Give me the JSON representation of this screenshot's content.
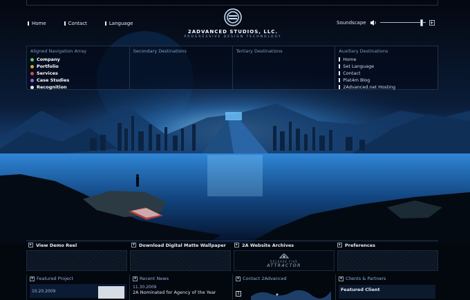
{
  "header": {
    "nav": [
      {
        "label": "Home"
      },
      {
        "label": "Contact"
      },
      {
        "label": "Language"
      }
    ],
    "logo_name": "2ADVANCED STUDIOS, LLC.",
    "logo_tagline": "PROGRESSIVE DESIGN TECHNOLOGY",
    "soundscape_label": "Soundscape",
    "soundscape_level": 0.93,
    "volume_plus": "+"
  },
  "navigation": {
    "primary": {
      "heading": "Aligned Navigation Array",
      "items": [
        {
          "label": "Company",
          "color": "#5ecf4b"
        },
        {
          "label": "Portfolio",
          "color": "#d9a233"
        },
        {
          "label": "Services",
          "color": "#d84d3b"
        },
        {
          "label": "Case Studies",
          "color": "#a65fd6"
        },
        {
          "label": "Recognition",
          "color": "#e6e6e6"
        }
      ]
    },
    "secondary": {
      "heading": "Secondary Destinations"
    },
    "tertiary": {
      "heading": "Tertiary Destinations"
    },
    "auxiliary": {
      "heading": "Auxiliary Destinations",
      "items": [
        {
          "label": "Home"
        },
        {
          "label": "Set Language"
        },
        {
          "label": "Contact"
        },
        {
          "label": "Plat4m Blog"
        },
        {
          "label": "2Advanced.net Hosting"
        }
      ]
    }
  },
  "quicklinks": [
    {
      "label": "View Demo Reel"
    },
    {
      "label": "Download Digital Matte Wallpaper"
    },
    {
      "label": "2A Website Archives"
    },
    {
      "label": "Preferences"
    }
  ],
  "banner": {
    "release_text": "RELEASE FIVE",
    "title": "ATTRACTOR"
  },
  "bottom": {
    "featured_project": {
      "heading": "Featured Project",
      "date": "10.20.2009"
    },
    "recent_news": {
      "heading": "Recent News",
      "date": "11.30.2009",
      "headline": "2A Nominated for Agency of the Year"
    },
    "contact": {
      "heading": "Contact 2Advanced",
      "marker": "1"
    },
    "clients": {
      "heading": "Clients & Partners",
      "featured_label": "Featured Client"
    }
  },
  "colors": {
    "accent": "#6fa8ff",
    "panel_border": "#2c435c"
  }
}
